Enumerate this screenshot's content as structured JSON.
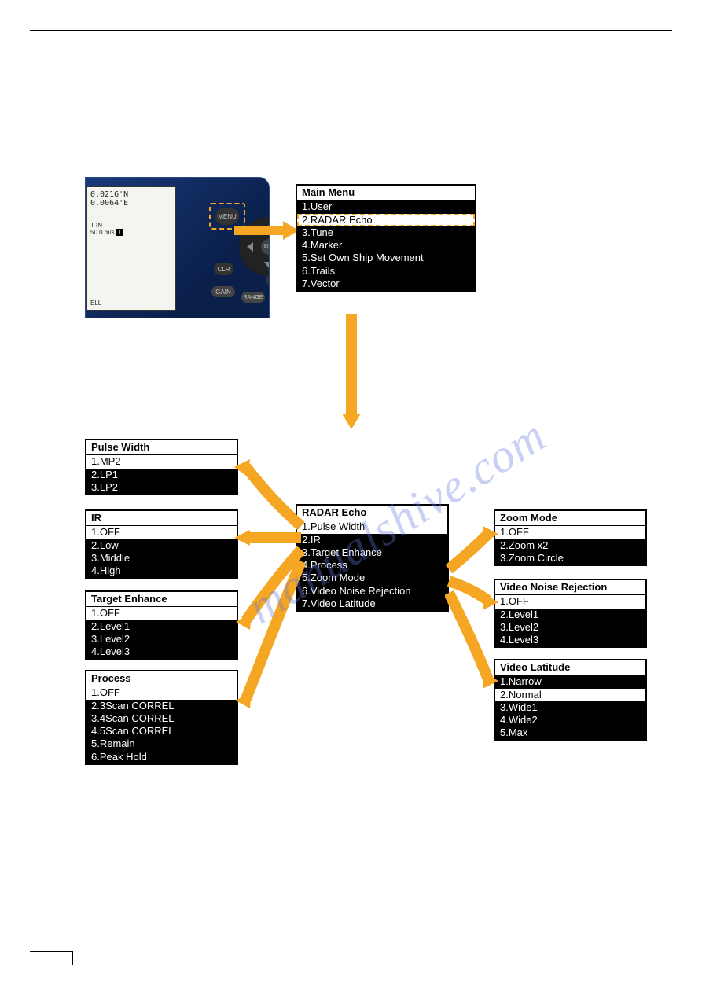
{
  "device": {
    "coord_n": "0.0216'N",
    "coord_e": "0.0064'E",
    "tin_label": "T IN",
    "speed": "50.0 m/s",
    "t_badge": "T",
    "ell_label": "ELL",
    "btn_menu": "MENU",
    "btn_clr": "CLR",
    "btn_gain": "GAIN",
    "btn_range": "RANGE",
    "btn_ent": "ENT",
    "btn_plus": "+"
  },
  "main_menu": {
    "title": "Main Menu",
    "items": [
      {
        "label": "1.User",
        "selected": false
      },
      {
        "label": "2.RADAR Echo",
        "selected": true,
        "dashed": true
      },
      {
        "label": "3.Tune",
        "selected": false
      },
      {
        "label": "4.Marker",
        "selected": false
      },
      {
        "label": "5.Set Own Ship Movement",
        "selected": false
      },
      {
        "label": "6.Trails",
        "selected": false
      },
      {
        "label": "7.Vector",
        "selected": false
      }
    ]
  },
  "radar_echo": {
    "title": "RADAR Echo",
    "items": [
      {
        "label": "1.Pulse Width",
        "selected": true
      },
      {
        "label": "2.IR",
        "selected": false
      },
      {
        "label": "3.Target Enhance",
        "selected": false
      },
      {
        "label": "4.Process",
        "selected": false
      },
      {
        "label": "5.Zoom Mode",
        "selected": false
      },
      {
        "label": "6.Video Noise Rejection",
        "selected": false
      },
      {
        "label": "7.Video Latitude",
        "selected": false
      }
    ]
  },
  "pulse_width": {
    "title": "Pulse Width",
    "items": [
      {
        "label": "1.MP2",
        "selected": true
      },
      {
        "label": "2.LP1",
        "selected": false
      },
      {
        "label": "3.LP2",
        "selected": false
      }
    ]
  },
  "ir": {
    "title": "IR",
    "items": [
      {
        "label": "1.OFF",
        "selected": true
      },
      {
        "label": "2.Low",
        "selected": false
      },
      {
        "label": "3.Middle",
        "selected": false
      },
      {
        "label": "4.High",
        "selected": false
      }
    ]
  },
  "target_enhance": {
    "title": "Target Enhance",
    "items": [
      {
        "label": "1.OFF",
        "selected": true
      },
      {
        "label": "2.Level1",
        "selected": false
      },
      {
        "label": "3.Level2",
        "selected": false
      },
      {
        "label": "4.Level3",
        "selected": false
      }
    ]
  },
  "process": {
    "title": "Process",
    "items": [
      {
        "label": "1.OFF",
        "selected": true
      },
      {
        "label": "2.3Scan CORREL",
        "selected": false
      },
      {
        "label": "3.4Scan CORREL",
        "selected": false
      },
      {
        "label": "4.5Scan CORREL",
        "selected": false
      },
      {
        "label": "5.Remain",
        "selected": false
      },
      {
        "label": "6.Peak Hold",
        "selected": false
      }
    ]
  },
  "zoom_mode": {
    "title": "Zoom Mode",
    "items": [
      {
        "label": "1.OFF",
        "selected": true
      },
      {
        "label": "2.Zoom x2",
        "selected": false
      },
      {
        "label": "3.Zoom Circle",
        "selected": false
      }
    ]
  },
  "vnr": {
    "title": "Video Noise Rejection",
    "items": [
      {
        "label": "1.OFF",
        "selected": true
      },
      {
        "label": "2.Level1",
        "selected": false
      },
      {
        "label": "3.Level2",
        "selected": false
      },
      {
        "label": "4.Level3",
        "selected": false
      }
    ]
  },
  "video_latitude": {
    "title": "Video Latitude",
    "items": [
      {
        "label": "1.Narrow",
        "selected": false
      },
      {
        "label": "2.Normal",
        "selected": true
      },
      {
        "label": "3.Wide1",
        "selected": false
      },
      {
        "label": "4.Wide2",
        "selected": false
      },
      {
        "label": "5.Max",
        "selected": false
      }
    ]
  },
  "watermark": "manualshive.com"
}
